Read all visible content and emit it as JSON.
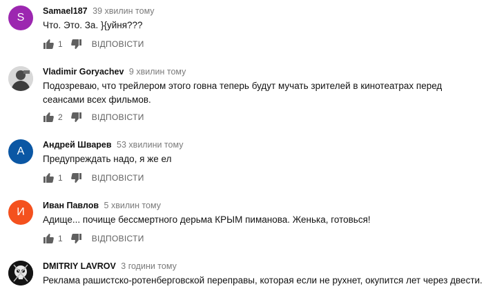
{
  "comments": [
    {
      "author": "Samael187",
      "time": "39 хвилин тому",
      "text": "Что. Это. За. }{уйня???",
      "likes": "1",
      "reply": "ВІДПОВІСТИ",
      "avatar_letter": "S",
      "avatar_color": "#9c27b0"
    },
    {
      "author": "Vladimir Goryachev",
      "time": "9 хвилин тому",
      "text": "Подозреваю, что трейлером этого говна теперь будут мучать зрителей в кинотеатрах перед сеансами всех фильмов.",
      "likes": "2",
      "reply": "ВІДПОВІСТИ",
      "avatar_color": "#5a5a5a"
    },
    {
      "author": "Андрей Шварев",
      "time": "53 хвилини тому",
      "text": "Предупреждать надо, я же ел",
      "likes": "1",
      "reply": "ВІДПОВІСТИ",
      "avatar_letter": "А",
      "avatar_color": "#0b57a4"
    },
    {
      "author": "Иван Павлов",
      "time": "5 хвилин тому",
      "text": "Адище... почище бессмертного дерьма КРЫМ пиманова. Женька, готовься!",
      "likes": "1",
      "reply": "ВІДПОВІСТИ",
      "avatar_letter": "И",
      "avatar_color": "#f4511e"
    },
    {
      "author": "DMITRIY LAVROV",
      "time": "3 години тому",
      "text": "Реклама рашистско-ротенберговской переправы, которая если не рухнет, окупится лет через двести.",
      "avatar_color": "#1a1a1a"
    }
  ]
}
